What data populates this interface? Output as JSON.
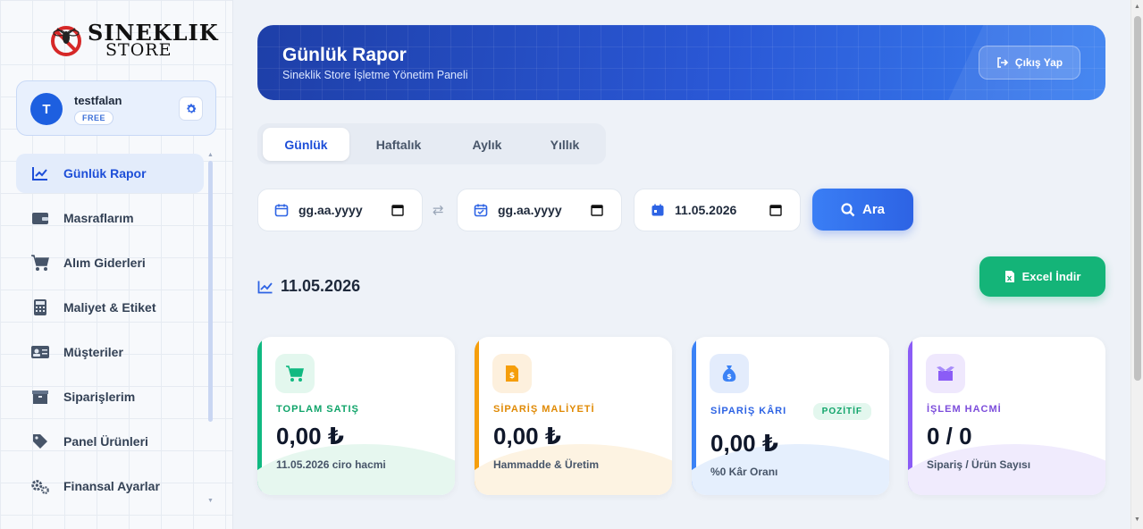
{
  "brand": {
    "line1": "SINEKLIK",
    "line2": "STORE"
  },
  "user": {
    "initial": "T",
    "name": "testfalan",
    "plan": "FREE"
  },
  "nav": [
    {
      "label": "Günlük Rapor",
      "icon": "chart-line-icon"
    },
    {
      "label": "Masraflarım",
      "icon": "wallet-icon"
    },
    {
      "label": "Alım Giderleri",
      "icon": "cart-icon"
    },
    {
      "label": "Maliyet & Etiket",
      "icon": "calculator-icon"
    },
    {
      "label": "Müşteriler",
      "icon": "id-card-icon"
    },
    {
      "label": "Siparişlerim",
      "icon": "box-icon"
    },
    {
      "label": "Panel Ürünleri",
      "icon": "tag-icon"
    },
    {
      "label": "Finansal Ayarlar",
      "icon": "gears-icon"
    }
  ],
  "header": {
    "title": "Günlük Rapor",
    "subtitle": "Sineklik Store İşletme Yönetim Paneli",
    "logout": "Çıkış Yap"
  },
  "tabs": [
    "Günlük",
    "Haftalık",
    "Aylık",
    "Yıllık"
  ],
  "filters": {
    "start_placeholder": "gg.aa.yyyy",
    "end_placeholder": "gg.aa.yyyy",
    "date_value": "11.05.2026",
    "search_label": "Ara"
  },
  "section": {
    "date": "11.05.2026",
    "excel_label": "Excel İndir"
  },
  "cards": [
    {
      "label": "TOPLAM SATIŞ",
      "value": "0,00 ₺",
      "sub": "11.05.2026 ciro hacmi",
      "accent": "#10b981"
    },
    {
      "label": "SİPARİŞ MALİYETİ",
      "value": "0,00 ₺",
      "sub": "Hammadde & Üretim",
      "accent": "#f59e0b"
    },
    {
      "label": "SİPARİŞ KÂRI",
      "value": "0,00 ₺",
      "sub": "%0 Kâr Oranı",
      "badge": "POZİTİF",
      "accent": "#3b82f6"
    },
    {
      "label": "İŞLEM HACMİ",
      "value": "0 / 0",
      "sub": "Sipariş / Ürün Sayısı",
      "accent": "#8b5cf6"
    }
  ]
}
